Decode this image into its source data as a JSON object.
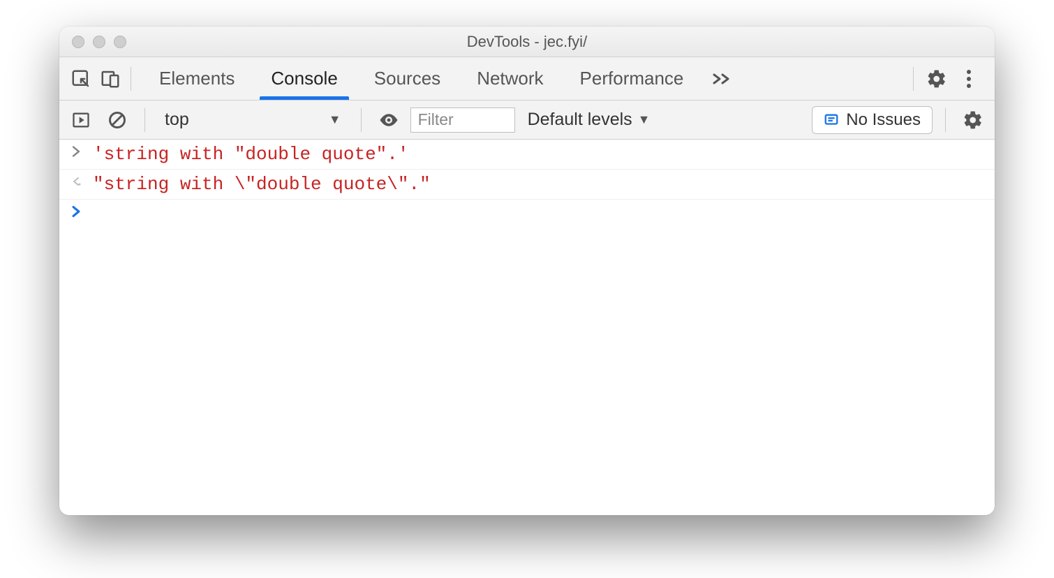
{
  "window": {
    "title": "DevTools - jec.fyi/"
  },
  "tabs": {
    "items": [
      "Elements",
      "Console",
      "Sources",
      "Network",
      "Performance"
    ],
    "active_index": 1
  },
  "console_toolbar": {
    "context_label": "top",
    "filter_placeholder": "Filter",
    "levels_label": "Default levels",
    "issues_label": "No Issues"
  },
  "console_rows": {
    "input": "'string with \"double quote\".'",
    "output": "\"string with \\\"double quote\\\".\""
  }
}
